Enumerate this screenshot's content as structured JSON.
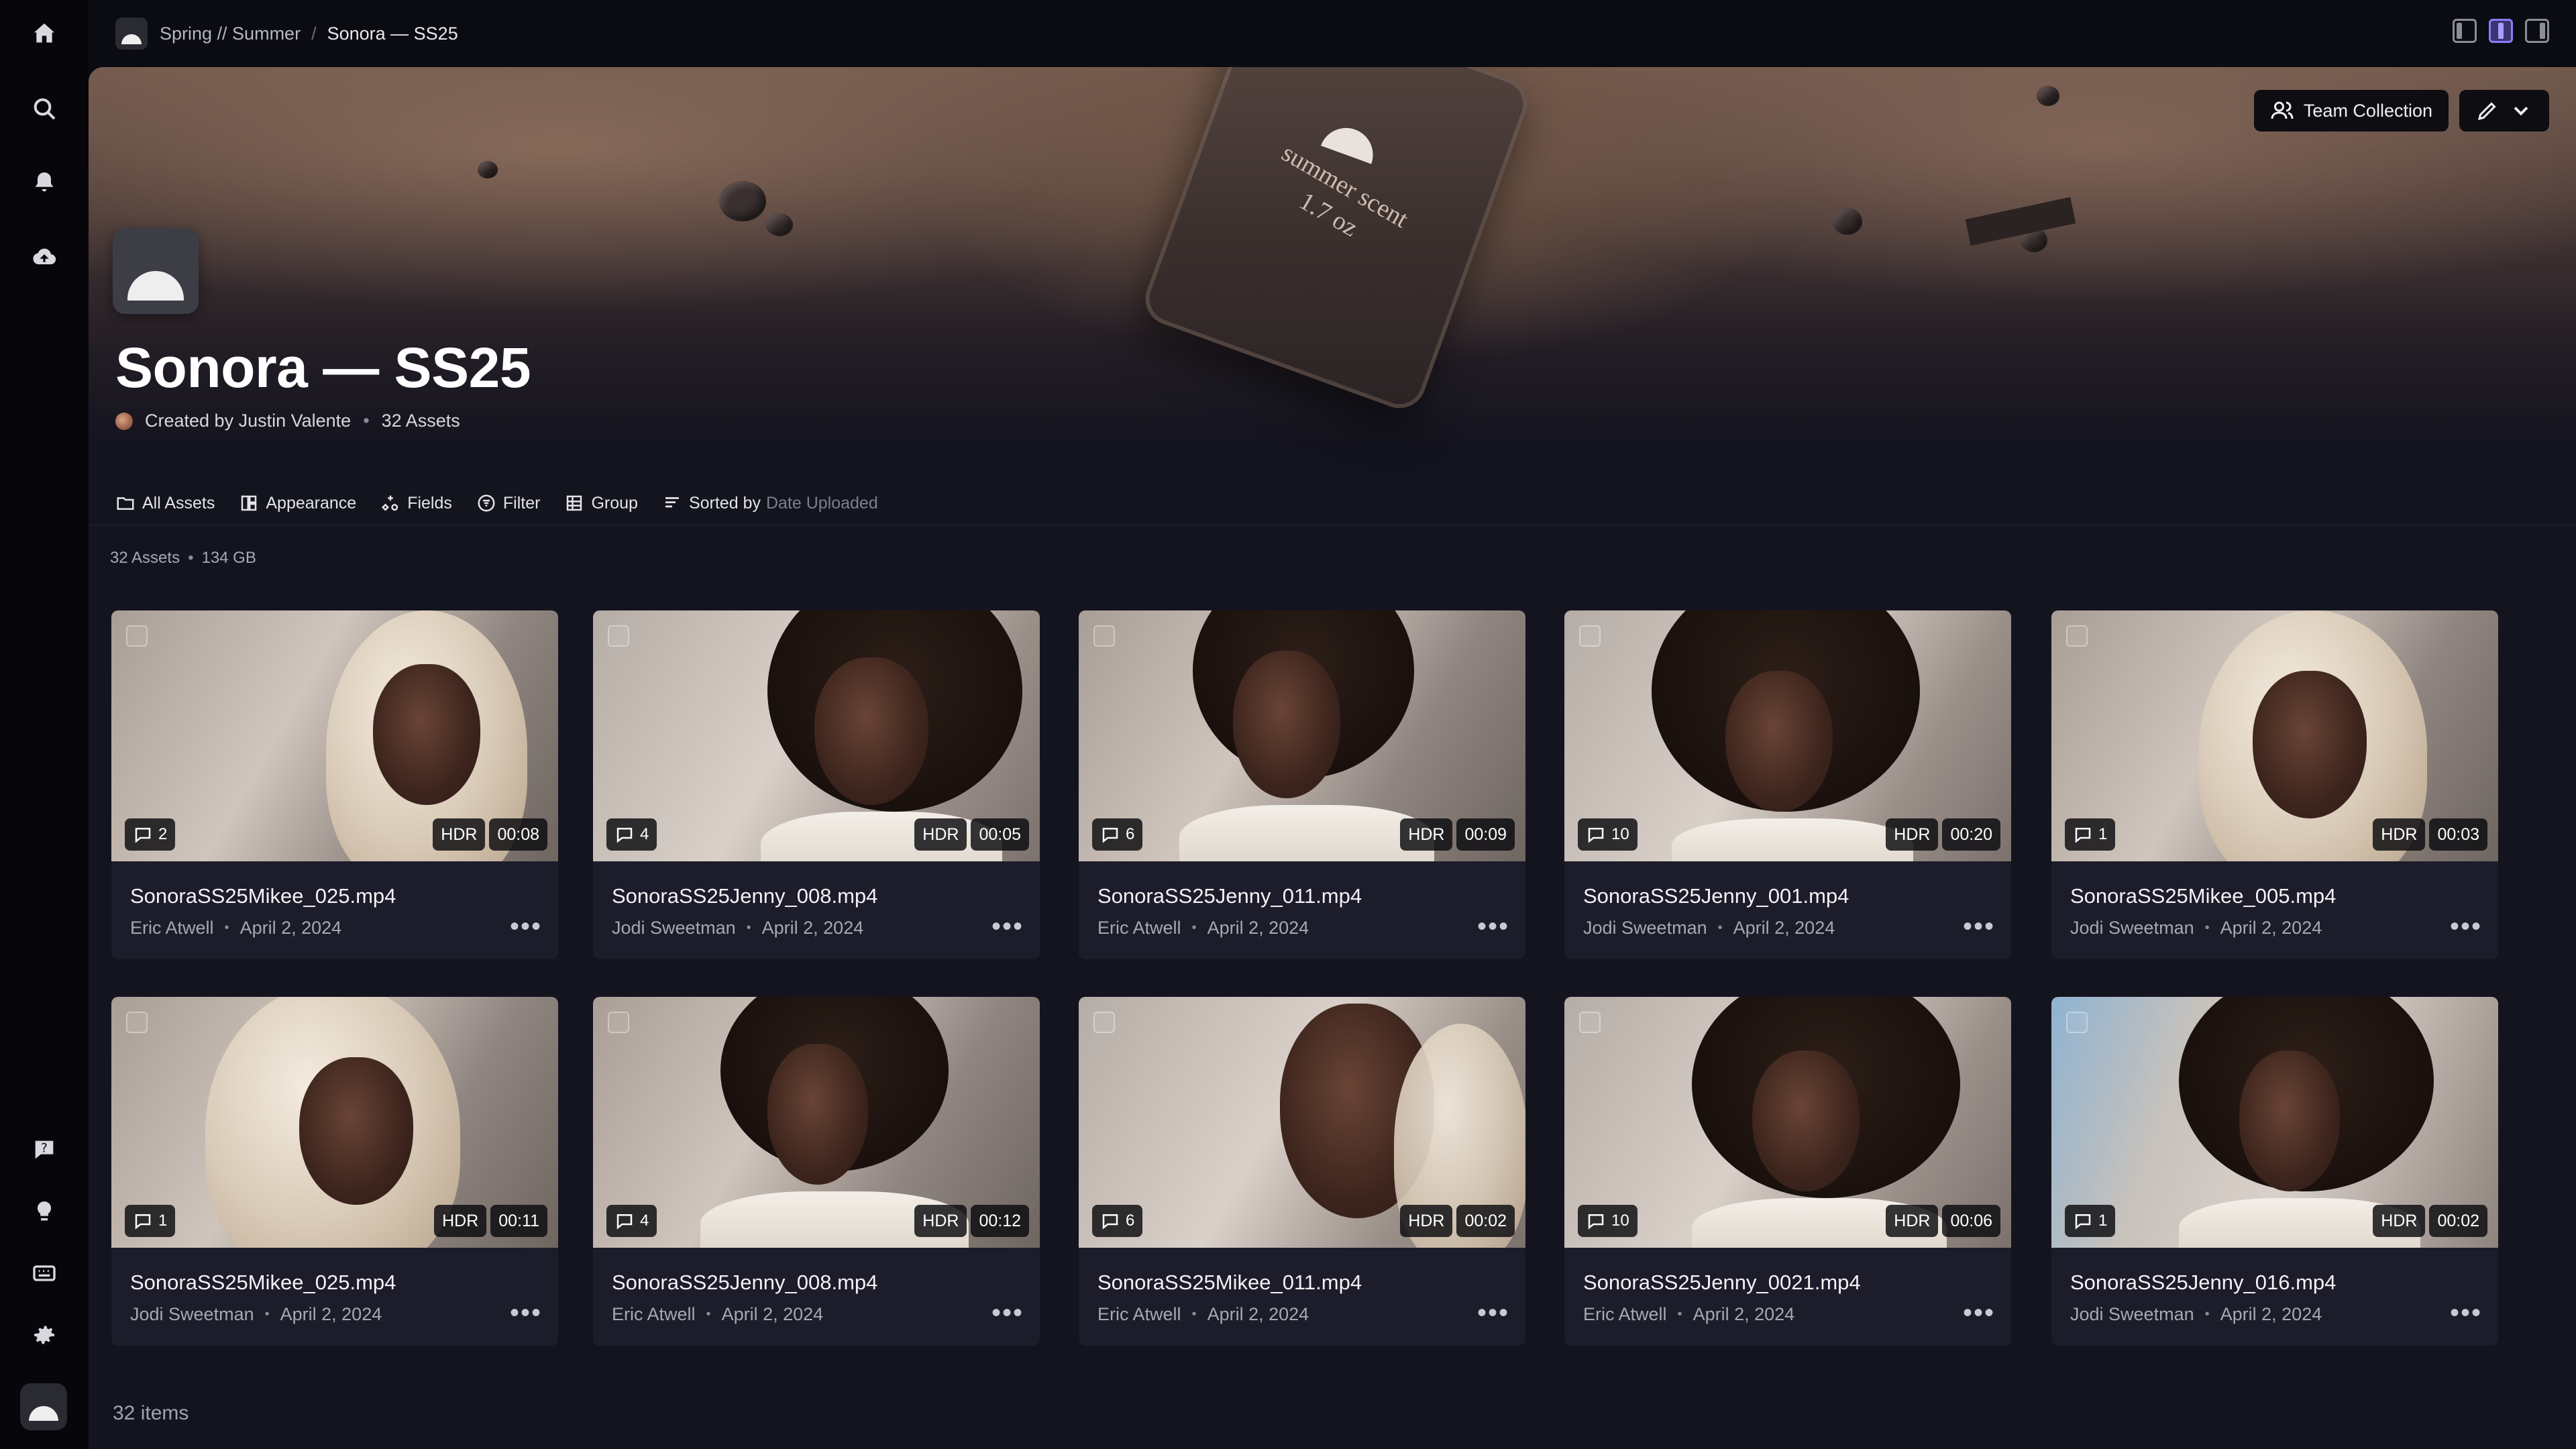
{
  "breadcrumb": {
    "parent": "Spring // Summer",
    "separator": "/",
    "current": "Sonora — SS25"
  },
  "hero": {
    "bottle_text_line1": "summer scent",
    "bottle_text_line2": "1.7 oz",
    "team_button": "Team Collection",
    "title": "Sonora — SS25",
    "created_by": "Created by Justin Valente",
    "asset_count": "32 Assets"
  },
  "toolbar": {
    "all_assets": "All Assets",
    "appearance": "Appearance",
    "fields": "Fields",
    "filter": "Filter",
    "group": "Group",
    "sorted_by": "Sorted by",
    "sort_field": "Date Uploaded"
  },
  "summary": {
    "assets": "32 Assets",
    "size": "134 GB"
  },
  "cards": [
    {
      "name": "SonoraSS25Mikee_025.mp4",
      "author": "Eric Atwell",
      "date": "April 2, 2024",
      "comments": "2",
      "hdr": "HDR",
      "duration": "00:08"
    },
    {
      "name": "SonoraSS25Jenny_008.mp4",
      "author": "Jodi Sweetman",
      "date": "April 2, 2024",
      "comments": "4",
      "hdr": "HDR",
      "duration": "00:05"
    },
    {
      "name": "SonoraSS25Jenny_011.mp4",
      "author": "Eric Atwell",
      "date": "April 2, 2024",
      "comments": "6",
      "hdr": "HDR",
      "duration": "00:09"
    },
    {
      "name": "SonoraSS25Jenny_001.mp4",
      "author": "Jodi Sweetman",
      "date": "April 2, 2024",
      "comments": "10",
      "hdr": "HDR",
      "duration": "00:20"
    },
    {
      "name": "SonoraSS25Mikee_005.mp4",
      "author": "Jodi Sweetman",
      "date": "April 2, 2024",
      "comments": "1",
      "hdr": "HDR",
      "duration": "00:03"
    },
    {
      "name": "SonoraSS25Mikee_025.mp4",
      "author": "Jodi Sweetman",
      "date": "April 2, 2024",
      "comments": "1",
      "hdr": "HDR",
      "duration": "00:11"
    },
    {
      "name": "SonoraSS25Jenny_008.mp4",
      "author": "Eric Atwell",
      "date": "April 2, 2024",
      "comments": "4",
      "hdr": "HDR",
      "duration": "00:12"
    },
    {
      "name": "SonoraSS25Mikee_011.mp4",
      "author": "Eric Atwell",
      "date": "April 2, 2024",
      "comments": "6",
      "hdr": "HDR",
      "duration": "00:02"
    },
    {
      "name": "SonoraSS25Jenny_0021.mp4",
      "author": "Eric Atwell",
      "date": "April 2, 2024",
      "comments": "10",
      "hdr": "HDR",
      "duration": "00:06"
    },
    {
      "name": "SonoraSS25Jenny_016.mp4",
      "author": "Jodi Sweetman",
      "date": "April 2, 2024",
      "comments": "1",
      "hdr": "HDR",
      "duration": "00:02"
    }
  ],
  "footer": {
    "items_count": "32 items"
  },
  "icons": {
    "rail_top": [
      "home-icon",
      "search-icon",
      "bell-icon",
      "upload-cloud-icon"
    ],
    "rail_bottom": [
      "help-icon",
      "lightbulb-icon",
      "keyboard-icon",
      "gear-icon"
    ]
  },
  "colors": {
    "accent": "#8a7cff",
    "background": "#0b0b12",
    "panel": "#14141f",
    "card": "#1c1c2a"
  }
}
